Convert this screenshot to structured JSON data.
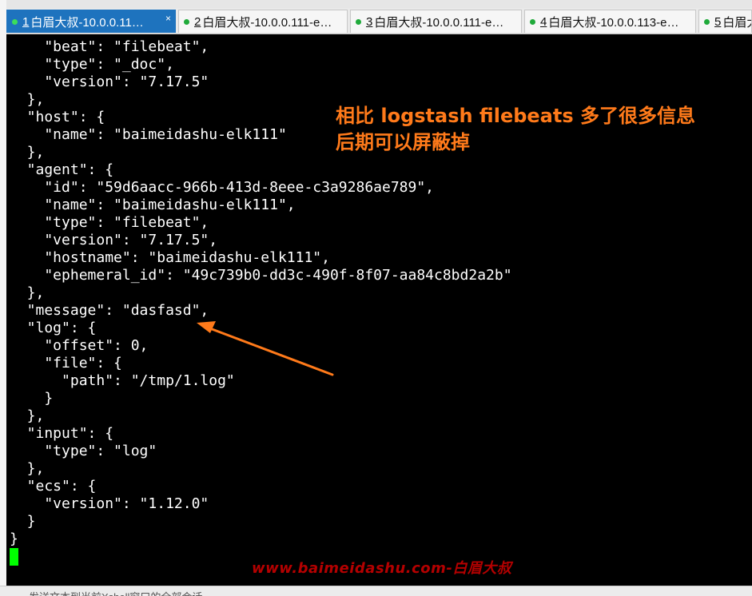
{
  "tabs": [
    {
      "num": "1",
      "label": "白眉大叔-10.0.0.11…",
      "active": true,
      "close": "×"
    },
    {
      "num": "2",
      "label": "白眉大叔-10.0.0.111-e…",
      "active": false
    },
    {
      "num": "3",
      "label": "白眉大叔-10.0.0.111-e…",
      "active": false
    },
    {
      "num": "4",
      "label": "白眉大叔-10.0.0.113-e…",
      "active": false
    },
    {
      "num": "5",
      "label": "白眉大",
      "active": false
    }
  ],
  "terminal": {
    "lines": [
      "    \"beat\": \"filebeat\",",
      "    \"type\": \"_doc\",",
      "    \"version\": \"7.17.5\"",
      "  },",
      "  \"host\": {",
      "    \"name\": \"baimeidashu-elk111\"",
      "  },",
      "  \"agent\": {",
      "    \"id\": \"59d6aacc-966b-413d-8eee-c3a9286ae789\",",
      "    \"name\": \"baimeidashu-elk111\",",
      "    \"type\": \"filebeat\",",
      "    \"version\": \"7.17.5\",",
      "    \"hostname\": \"baimeidashu-elk111\",",
      "    \"ephemeral_id\": \"49c739b0-dd3c-490f-8f07-aa84c8bd2a2b\"",
      "  },",
      "  \"message\": \"dasfasd\",",
      "  \"log\": {",
      "    \"offset\": 0,",
      "    \"file\": {",
      "      \"path\": \"/tmp/1.log\"",
      "    }",
      "  },",
      "  \"input\": {",
      "    \"type\": \"log\"",
      "  },",
      "  \"ecs\": {",
      "    \"version\": \"1.12.0\"",
      "  }",
      "}"
    ]
  },
  "annotation": {
    "line1": "相比 logstash  filebeats 多了很多信息",
    "line2": "后期可以屏蔽掉",
    "color": "#ff7a1a"
  },
  "watermark": "www.baimeidashu.com-白眉大叔",
  "statusbar": {
    "text": "发送文本到当前Xshell窗口的全部会话"
  }
}
